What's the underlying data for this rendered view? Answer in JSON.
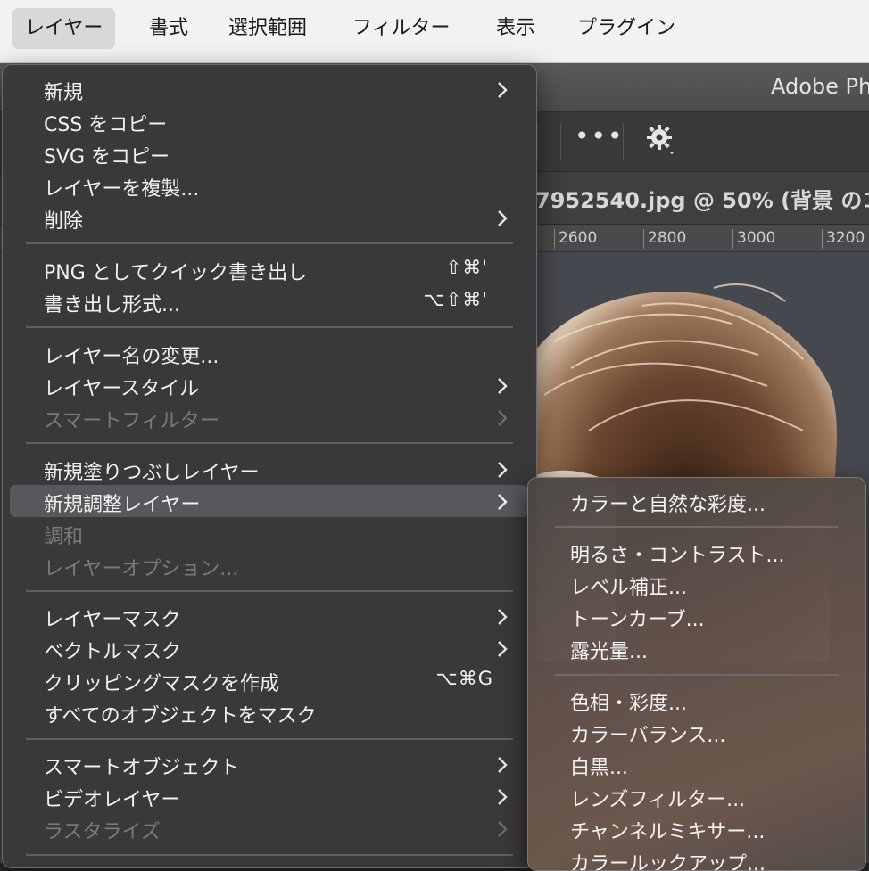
{
  "menubar": {
    "items": [
      {
        "label": "レイヤー",
        "active": true
      },
      {
        "label": "書式"
      },
      {
        "label": "選択範囲"
      },
      {
        "label": "フィルター"
      },
      {
        "label": "表示"
      },
      {
        "label": "プラグイン"
      }
    ]
  },
  "ps_window": {
    "title": "Adobe Ph",
    "doc_tab": "7952540.jpg @ 50% (背景 のコ",
    "ruler_ticks": [
      "2600",
      "2800",
      "3000",
      "3200"
    ],
    "toolbar_more": "•••"
  },
  "layer_menu": {
    "items": [
      {
        "label": "新規",
        "submenu": true
      },
      {
        "label": "CSS をコピー"
      },
      {
        "label": "SVG をコピー"
      },
      {
        "label": "レイヤーを複製..."
      },
      {
        "label": "削除",
        "submenu": true
      },
      {
        "label": "PNG としてクイック書き出し",
        "shortcut": "⇧⌘'"
      },
      {
        "label": "書き出し形式...",
        "shortcut": "⌥⇧⌘'"
      },
      {
        "label": "レイヤー名の変更..."
      },
      {
        "label": "レイヤースタイル",
        "submenu": true
      },
      {
        "label": "スマートフィルター",
        "submenu": true,
        "disabled": true
      },
      {
        "label": "新規塗りつぶしレイヤー",
        "submenu": true
      },
      {
        "label": "新規調整レイヤー",
        "submenu": true,
        "highlighted": true
      },
      {
        "label": "調和",
        "disabled": true
      },
      {
        "label": "レイヤーオプション...",
        "disabled": true
      },
      {
        "label": "レイヤーマスク",
        "submenu": true
      },
      {
        "label": "ベクトルマスク",
        "submenu": true
      },
      {
        "label": "クリッピングマスクを作成",
        "shortcut": "⌥⌘G"
      },
      {
        "label": "すべてのオブジェクトをマスク"
      },
      {
        "label": "スマートオブジェクト",
        "submenu": true
      },
      {
        "label": "ビデオレイヤー",
        "submenu": true
      },
      {
        "label": "ラスタライズ",
        "submenu": true,
        "disabled": true
      }
    ]
  },
  "adjustment_submenu": {
    "items": [
      {
        "label": "カラーと自然な彩度..."
      },
      {
        "label": "明るさ・コントラスト..."
      },
      {
        "label": "レベル補正..."
      },
      {
        "label": "トーンカーブ..."
      },
      {
        "label": "露光量..."
      },
      {
        "label": "色相・彩度..."
      },
      {
        "label": "カラーバランス..."
      },
      {
        "label": "白黒..."
      },
      {
        "label": "レンズフィルター..."
      },
      {
        "label": "チャンネルミキサー..."
      },
      {
        "label": "カラールックアップ..."
      }
    ]
  },
  "colors": {
    "menu_bg": "#3a3838",
    "menu_highlight": "#57575c",
    "menubar_bg": "#f2f2f2",
    "menubar_active": "#d8d8d8",
    "text": "#f2f2f2",
    "disabled_text": "#7a7a7a"
  },
  "icons": [
    "chevron-right-icon",
    "more-icon",
    "gear-icon"
  ]
}
